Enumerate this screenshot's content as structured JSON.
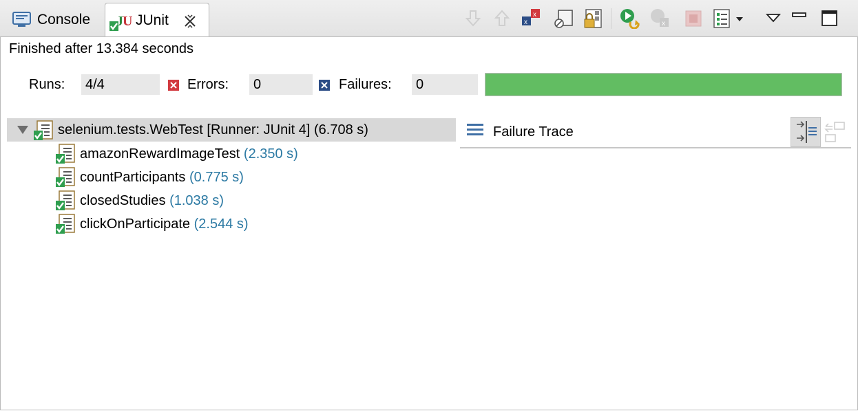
{
  "tabs": [
    {
      "label": "Console"
    },
    {
      "label": "JUnit"
    }
  ],
  "status": {
    "text": "Finished after 13.384 seconds"
  },
  "counters": {
    "runs_label": "Runs:",
    "runs_value": "4/4",
    "errors_label": "Errors:",
    "errors_value": "0",
    "failures_label": "Failures:",
    "failures_value": "0"
  },
  "progress": {
    "fraction": 1.0,
    "color": "#62bd62"
  },
  "tree": {
    "root": {
      "label": "selenium.tests.WebTest [Runner: JUnit 4] (6.708 s)"
    },
    "tests": [
      {
        "name": "amazonRewardImageTest",
        "time": "(2.350 s)"
      },
      {
        "name": "countParticipants",
        "time": "(0.775 s)"
      },
      {
        "name": "closedStudies",
        "time": "(1.038 s)"
      },
      {
        "name": "clickOnParticipate",
        "time": "(2.544 s)"
      }
    ]
  },
  "failure_trace": {
    "title": "Failure Trace"
  },
  "toolbar_icons": [
    "next-failure-icon",
    "previous-failure-icon",
    "show-failures-only-icon",
    "scroll-lock-icon",
    "lock-icon",
    "rerun-icon",
    "rerun-failed-first-icon",
    "stop-icon",
    "history-icon",
    "view-menu-icon",
    "minimize-icon",
    "maximize-icon"
  ]
}
